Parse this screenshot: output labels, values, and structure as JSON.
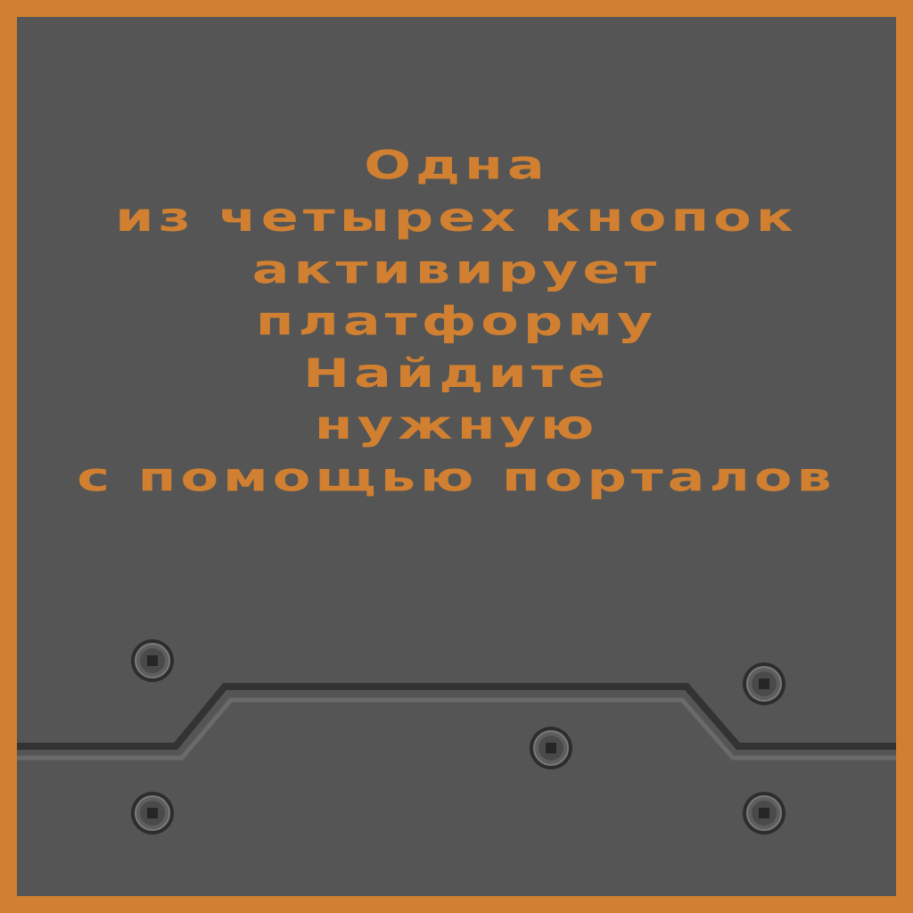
{
  "colors": {
    "frame": "#d08030",
    "panel": "#555555",
    "text": "#d08030",
    "seam_dark": "#333333",
    "seam_light": "#6a6a6a",
    "bolt": "#2d2d2d"
  },
  "hint_lines": [
    "Одна",
    "из четырех кнопок",
    "активирует",
    "платформу",
    "Найдите",
    "нужную",
    "с помощью порталов"
  ],
  "decor": {
    "bolt_count": 5,
    "bolt_icon": "bolt-icon",
    "seam_icon": "panel-seam"
  }
}
